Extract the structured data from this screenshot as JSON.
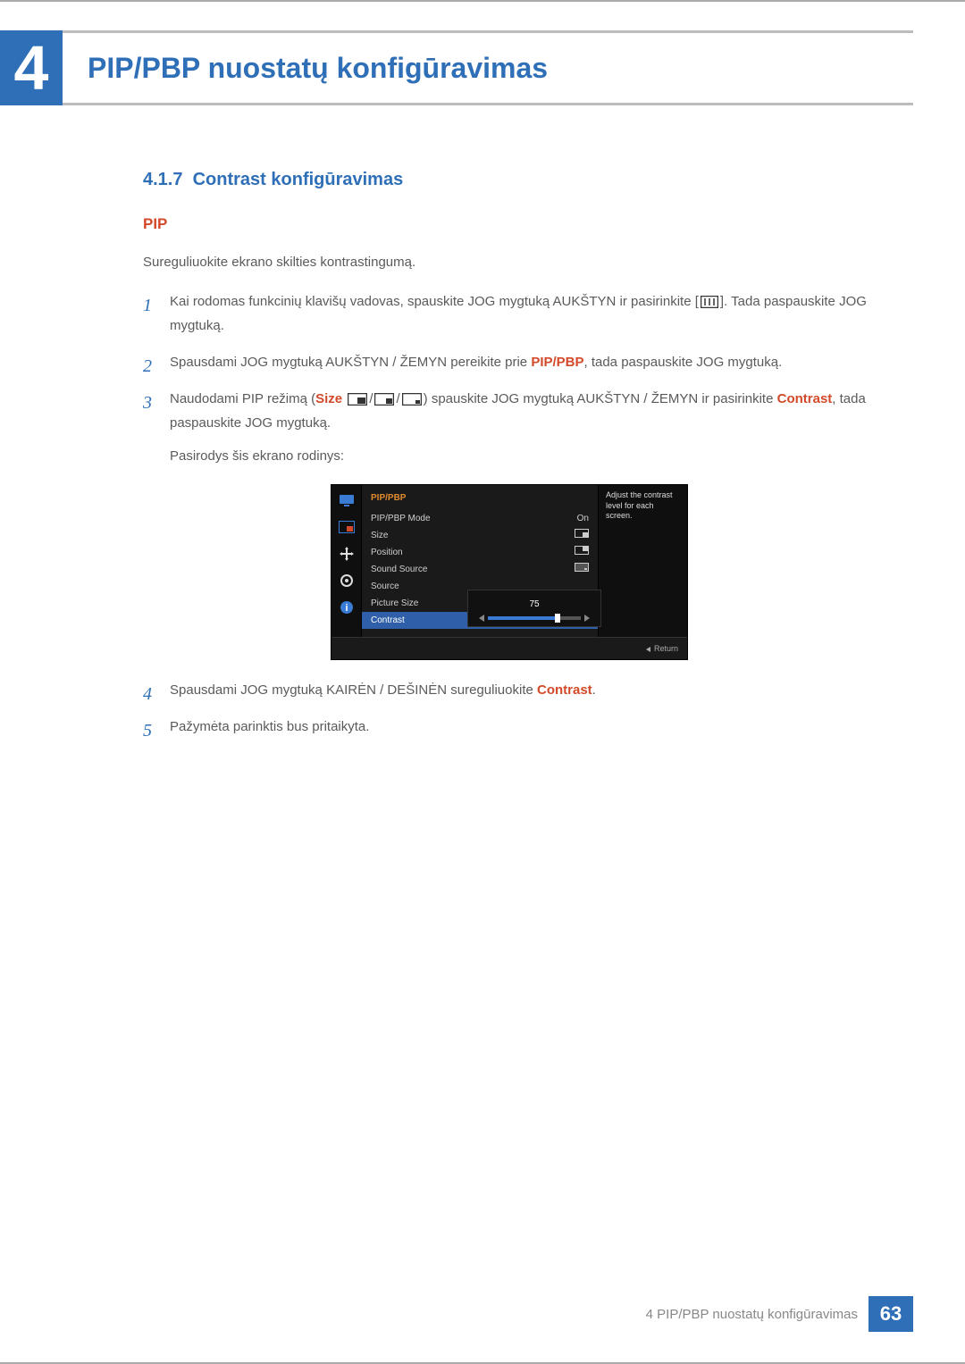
{
  "chapter": {
    "number": "4",
    "title": "PIP/PBP nuostatų konfigūravimas"
  },
  "section": {
    "number": "4.1.7",
    "title": "Contrast konfigūravimas"
  },
  "sub": "PIP",
  "intro": "Sureguliuokite ekrano skilties kontrastingumą.",
  "steps": {
    "s1a": "Kai rodomas funkcinių klavišų vadovas, spauskite JOG mygtuką AUKŠTYN ir pasirinkite [",
    "s1b": "]. Tada paspauskite JOG mygtuką.",
    "s2a": "Spausdami JOG mygtuką AUKŠTYN / ŽEMYN pereikite prie ",
    "s2_hl": "PIP/PBP",
    "s2b": ", tada paspauskite JOG mygtuką.",
    "s3a": "Naudodami PIP režimą (",
    "s3_size": "Size",
    "s3b": ") spauskite JOG mygtuką AUKŠTYN / ŽEMYN ir pasirinkite ",
    "s3_hl": "Contrast",
    "s3c": ", tada paspauskite JOG mygtuką.",
    "s3_follow": "Pasirodys šis ekrano rodinys:",
    "s4a": "Spausdami JOG mygtuką KAIRĖN / DEŠINĖN sureguliuokite ",
    "s4_hl": "Contrast",
    "s4b": ".",
    "s5": "Pažymėta parinktis bus pritaikyta."
  },
  "osd": {
    "title": "PIP/PBP",
    "help": "Adjust the contrast level for each screen.",
    "rows": {
      "mode": "PIP/PBP Mode",
      "mode_val": "On",
      "size": "Size",
      "position": "Position",
      "sound": "Sound Source",
      "source": "Source",
      "picture": "Picture Size",
      "contrast": "Contrast"
    },
    "slider_value": "75",
    "return": "Return"
  },
  "footer": {
    "text": "4 PIP/PBP nuostatų konfigūravimas",
    "page": "63"
  }
}
